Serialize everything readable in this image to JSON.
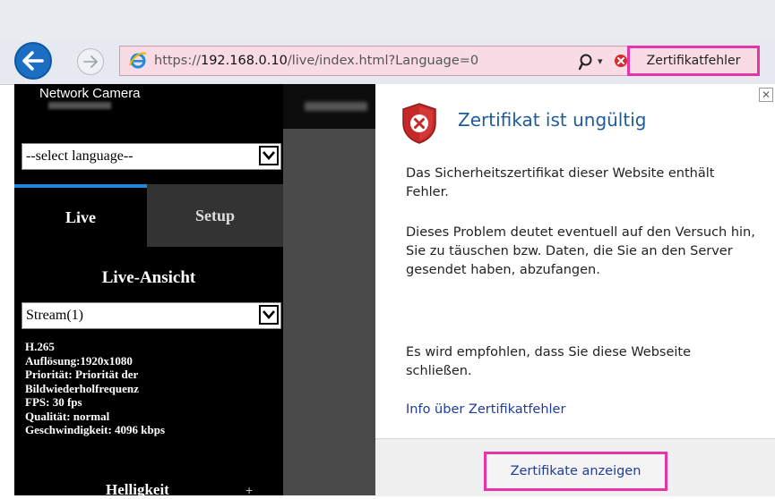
{
  "browser": {
    "url_scheme": "https://",
    "url_domain": "192.168.0.10",
    "url_path": "/live/index.html?Language=0",
    "cert_error_tab": "Zertifikatfehler"
  },
  "camera": {
    "title": "Network Camera",
    "language_select": "--select language--",
    "tabs": {
      "live": "Live",
      "setup": "Setup"
    },
    "live_view_heading": "Live-Ansicht",
    "stream_select": "Stream(1)",
    "stream_info": [
      "H.265",
      "Auflösung:1920x1080",
      "Priorität: Priorität der",
      "Bildwiederholfrequenz",
      "FPS: 30 fps",
      "Qualität: normal",
      "Geschwindigkeit:  4096 kbps"
    ],
    "cut_off_label": "Helligkeit"
  },
  "cert_panel": {
    "title": "Zertifikat ist ungültig",
    "paragraph1": "Das Sicherheitszertifikat dieser Website enthält Fehler.",
    "paragraph2": "Dieses Problem deutet eventuell auf den Versuch hin, Sie zu täuschen bzw. Daten, die Sie an den Server gesendet haben, abzufangen.",
    "paragraph3": "Es wird empfohlen, dass Sie diese Webseite schließen.",
    "more_link": "Info über Zertifikatfehler",
    "view_button": "Zertifikate anzeigen"
  },
  "colors": {
    "highlight": "#e535a6",
    "address_bar_error": "#f9dbe6",
    "title_blue": "#1d5b9b",
    "link_blue": "#1f3d99",
    "tab_accent": "#1d8ad8"
  },
  "icons": [
    "back-arrow-icon",
    "forward-arrow-icon",
    "ie-logo-icon",
    "search-icon",
    "chevron-down-icon",
    "certificate-error-icon",
    "close-icon",
    "shield-error-icon"
  ]
}
